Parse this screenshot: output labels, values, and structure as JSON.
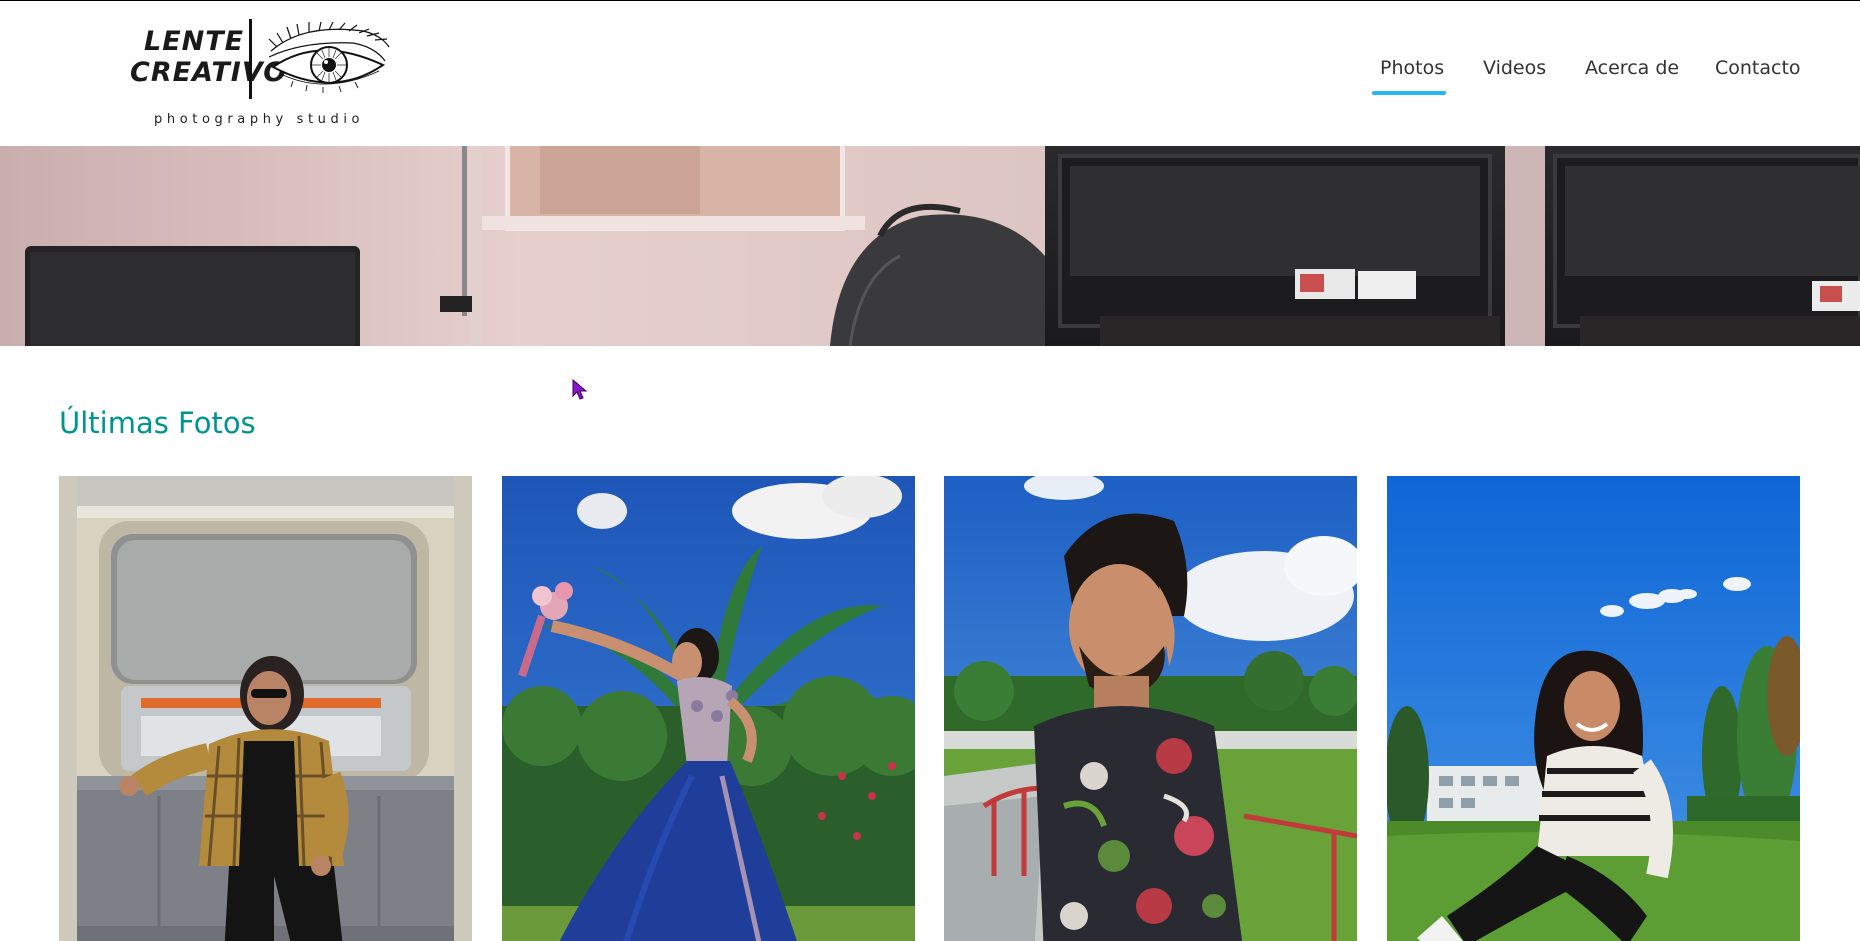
{
  "header": {
    "logo": {
      "line1": "LENTE",
      "line2": "CREATIVO",
      "tagline": "photography studio",
      "icon": "eye-logo-icon"
    },
    "nav": {
      "items": [
        {
          "label": "Photos",
          "active": true
        },
        {
          "label": "Videos",
          "active": false
        },
        {
          "label": "Acerca de",
          "active": false
        },
        {
          "label": "Contacto",
          "active": false
        }
      ]
    }
  },
  "hero": {
    "image": "office-desk-monitors-banner"
  },
  "section": {
    "title": "Últimas Fotos"
  },
  "gallery": {
    "photos": [
      {
        "image": "man-in-plaid-shirt-on-subway-seat"
      },
      {
        "image": "girl-in-blue-quinceanera-dress-with-bouquet"
      },
      {
        "image": "man-with-floral-shirt-outdoors"
      },
      {
        "image": "woman-sitting-on-grass-smiling"
      }
    ]
  },
  "colors": {
    "accent": "#00968f",
    "nav_underline": "#29b6f6",
    "nav_text": "#333333"
  }
}
